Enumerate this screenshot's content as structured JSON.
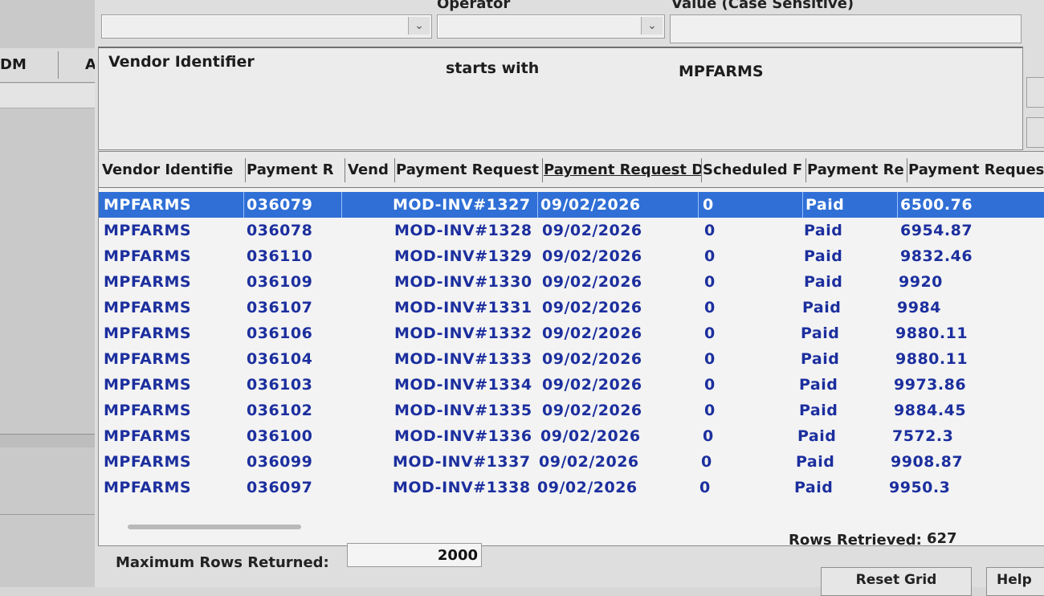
{
  "left_panel": {
    "col1_label": "DM",
    "col2_label": "A"
  },
  "criteria_header": {
    "operator_label": "Operator",
    "value_label": "Value (Case Sensitive)"
  },
  "criteria": {
    "field": "Vendor Identifier",
    "operator": "starts with",
    "value": "MPFARMS"
  },
  "grid": {
    "columns": [
      "Vendor Identifie",
      "Payment R",
      "Vend",
      "Payment Request",
      "Payment Request D",
      "Scheduled F",
      "Payment Re",
      "Payment Request T"
    ],
    "rows": [
      {
        "vendor": "MPFARMS",
        "payment": "036079",
        "invoice": "MOD-INV#1327",
        "date": "09/02/2026",
        "sched": "0",
        "status": "Paid",
        "amount": "6500.76"
      },
      {
        "vendor": "MPFARMS",
        "payment": "036078",
        "invoice": "MOD-INV#1328",
        "date": "09/02/2026",
        "sched": "0",
        "status": "Paid",
        "amount": "6954.87"
      },
      {
        "vendor": "MPFARMS",
        "payment": "036110",
        "invoice": "MOD-INV#1329",
        "date": "09/02/2026",
        "sched": "0",
        "status": "Paid",
        "amount": "9832.46"
      },
      {
        "vendor": "MPFARMS",
        "payment": "036109",
        "invoice": "MOD-INV#1330",
        "date": "09/02/2026",
        "sched": "0",
        "status": "Paid",
        "amount": "9920"
      },
      {
        "vendor": "MPFARMS",
        "payment": "036107",
        "invoice": "MOD-INV#1331",
        "date": "09/02/2026",
        "sched": "0",
        "status": "Paid",
        "amount": "9984"
      },
      {
        "vendor": "MPFARMS",
        "payment": "036106",
        "invoice": "MOD-INV#1332",
        "date": "09/02/2026",
        "sched": "0",
        "status": "Paid",
        "amount": "9880.11"
      },
      {
        "vendor": "MPFARMS",
        "payment": "036104",
        "invoice": "MOD-INV#1333",
        "date": "09/02/2026",
        "sched": "0",
        "status": "Paid",
        "amount": "9880.11"
      },
      {
        "vendor": "MPFARMS",
        "payment": "036103",
        "invoice": "MOD-INV#1334",
        "date": "09/02/2026",
        "sched": "0",
        "status": "Paid",
        "amount": "9973.86"
      },
      {
        "vendor": "MPFARMS",
        "payment": "036102",
        "invoice": "MOD-INV#1335",
        "date": "09/02/2026",
        "sched": "0",
        "status": "Paid",
        "amount": "9884.45"
      },
      {
        "vendor": "MPFARMS",
        "payment": "036100",
        "invoice": "MOD-INV#1336",
        "date": "09/02/2026",
        "sched": "0",
        "status": "Paid",
        "amount": "7572.3"
      },
      {
        "vendor": "MPFARMS",
        "payment": "036099",
        "invoice": "MOD-INV#1337",
        "date": "09/02/2026",
        "sched": "0",
        "status": "Paid",
        "amount": "9908.87"
      },
      {
        "vendor": "MPFARMS",
        "payment": "036097",
        "invoice": "MOD-INV#1338",
        "date": "09/02/2026",
        "sched": "0",
        "status": "Paid",
        "amount": "9950.3"
      }
    ]
  },
  "footer": {
    "max_rows_label": "Maximum Rows Returned:",
    "max_rows_value": "2000",
    "rows_retrieved_label": "Rows Retrieved:",
    "rows_retrieved_value": "627",
    "reset_grid_label": "Reset Grid",
    "help_label": "Help"
  },
  "colors": {
    "selection": "#2f6fd6",
    "cell_text": "#1c2f9e"
  }
}
